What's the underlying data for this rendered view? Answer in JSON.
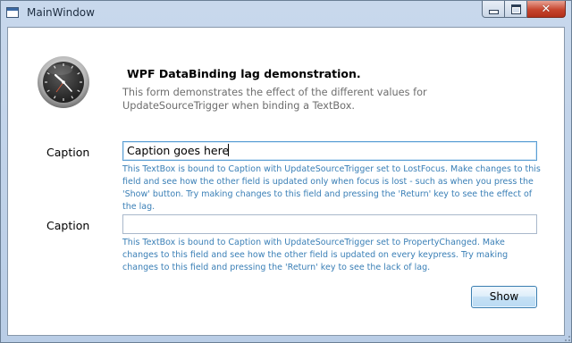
{
  "window": {
    "title": "MainWindow",
    "controls": {
      "minimize": "minimize-icon",
      "maximize": "maximize-icon",
      "close": "close-icon"
    }
  },
  "header": {
    "icon": "clock-icon",
    "title": "WPF DataBinding lag demonstration.",
    "description": "This form demonstrates the effect of the different values for UpdateSourceTrigger when binding a TextBox."
  },
  "fields": [
    {
      "label": "Caption",
      "value": "Caption goes here",
      "help": "This TextBox is bound to Caption with UpdateSourceTrigger set to LostFocus. Make changes to this field and see how the other field is updated only when focus is lost - such as when you press the 'Show' button. Try making changes to this field and pressing the 'Return' key to see the effect of the lag."
    },
    {
      "label": "Caption",
      "value": "",
      "help": "This TextBox is bound to Caption with UpdateSourceTrigger set to PropertyChanged. Make changes to this field and see how the other field is updated on every keypress. Try making changes to this field and pressing the 'Return' key to see the lack of lag."
    }
  ],
  "actions": {
    "show_label": "Show"
  },
  "colors": {
    "help_text": "#3a7fb6",
    "desc_text": "#6d6d6d",
    "focus_border": "#5c9fd4",
    "close_button": "#c6452e"
  }
}
